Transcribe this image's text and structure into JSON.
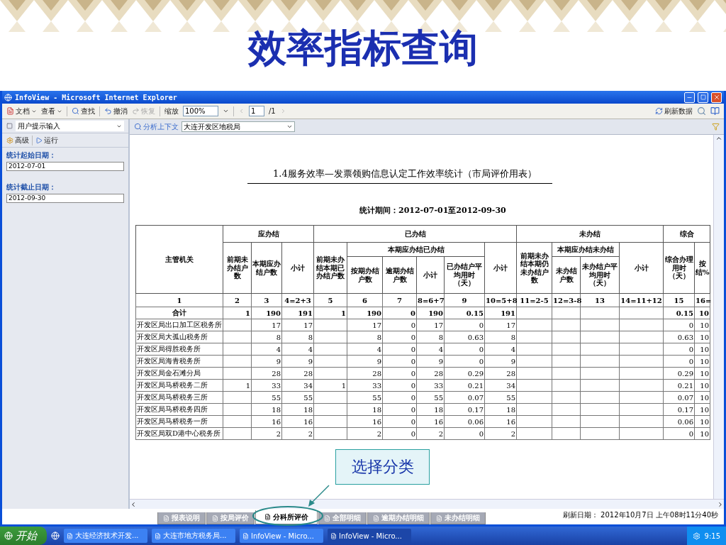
{
  "slide_title": "效率指标查询",
  "window": {
    "title": "InfoView - Microsoft Internet Explorer"
  },
  "toolbar": {
    "menus": [
      "文档",
      "查看"
    ],
    "find": "查找",
    "undo": {
      "label": "撤消",
      "disabled": false
    },
    "redo": {
      "label": "恢复",
      "disabled": true
    },
    "zoom_label": "缩放",
    "zoom_value": "100%",
    "page_value": "1",
    "page_total": "/1",
    "refresh": "刷新数据"
  },
  "prompt_panel": {
    "selector": "用户提示输入",
    "advanced": "高级",
    "run": "运行",
    "fields": [
      {
        "label": "统计起始日期：",
        "value": "2012-07-01"
      },
      {
        "label": "统计截止日期：",
        "value": "2012-09-30"
      }
    ]
  },
  "context_bar": {
    "label": "分析上下文",
    "value": "大连开发区地税局"
  },
  "report": {
    "title": "1.4服务效率—发票领购信息认定工作效率统计（市局评价用表）",
    "period": "统计期间：2012-07-01至2012-09-30",
    "columns": [
      {
        "label": "主管机关"
      },
      {
        "label": "应办结",
        "colspan": 3,
        "children": [
          {
            "label": "前期未办结户数"
          },
          {
            "label": "本期应办结户数"
          },
          {
            "label": "小计"
          }
        ]
      },
      {
        "label": "已办结",
        "colspan": 6,
        "children": [
          {
            "label": "前期未办结本期已办结户数"
          },
          {
            "label": "本期应办结已办结",
            "colspan": 4,
            "children": [
              {
                "label": "按期办结户数"
              },
              {
                "label": "逾期办结户数"
              },
              {
                "label": "小计"
              },
              {
                "label": "已办结户平均用时（天）"
              }
            ]
          },
          {
            "label": "小计"
          }
        ]
      },
      {
        "label": "未办结",
        "colspan": 4,
        "children": [
          {
            "label": "前期未办结本期仍未办结户数"
          },
          {
            "label": "本期应办结未办结",
            "colspan": 2,
            "children": [
              {
                "label": "未办结户数"
              },
              {
                "label": "未办结户平均用时（天）"
              }
            ]
          },
          {
            "label": "小计"
          }
        ]
      },
      {
        "label": "综合",
        "colspan": 2,
        "children": [
          {
            "label": "综合办理用时（天）"
          },
          {
            "label": "按结%"
          }
        ]
      }
    ],
    "index_row": [
      "1",
      "2",
      "3",
      "4=2+3",
      "5",
      "6",
      "7",
      "8=6+7",
      "9",
      "10=5+8",
      "11=2-5",
      "12=3-8",
      "13",
      "14=11+12",
      "15",
      "16="
    ],
    "rows": [
      {
        "kind": "total",
        "cells": [
          "合计",
          "1",
          "190",
          "191",
          "1",
          "190",
          "0",
          "190",
          "0.15",
          "191",
          null,
          null,
          null,
          null,
          "0.15",
          "10"
        ]
      },
      {
        "kind": "office",
        "cells": [
          "开发区局出口加工区税务所",
          null,
          "17",
          "17",
          null,
          "17",
          "0",
          "17",
          "0",
          "17",
          null,
          null,
          null,
          null,
          "0",
          "10"
        ]
      },
      {
        "kind": "office",
        "cells": [
          "开发区局大孤山税务所",
          null,
          "8",
          "8",
          null,
          "8",
          "0",
          "8",
          "0.63",
          "8",
          null,
          null,
          null,
          null,
          "0.63",
          "10"
        ]
      },
      {
        "kind": "office",
        "cells": [
          "开发区局得胜税务所",
          null,
          "4",
          "4",
          null,
          "4",
          "0",
          "4",
          "0",
          "4",
          null,
          null,
          null,
          null,
          "0",
          "10"
        ]
      },
      {
        "kind": "office",
        "cells": [
          "开发区局海青税务所",
          null,
          "9",
          "9",
          null,
          "9",
          "0",
          "9",
          "0",
          "9",
          null,
          null,
          null,
          null,
          "0",
          "10"
        ]
      },
      {
        "kind": "office",
        "cells": [
          "开发区局金石滩分局",
          null,
          "28",
          "28",
          null,
          "28",
          "0",
          "28",
          "0.29",
          "28",
          null,
          null,
          null,
          null,
          "0.29",
          "10"
        ]
      },
      {
        "kind": "office",
        "cells": [
          "开发区局马桥税务二所",
          "1",
          "33",
          "34",
          "1",
          "33",
          "0",
          "33",
          "0.21",
          "34",
          null,
          null,
          null,
          null,
          "0.21",
          "10"
        ]
      },
      {
        "kind": "office",
        "cells": [
          "开发区局马桥税务三所",
          null,
          "55",
          "55",
          null,
          "55",
          "0",
          "55",
          "0.07",
          "55",
          null,
          null,
          null,
          null,
          "0.07",
          "10"
        ]
      },
      {
        "kind": "office",
        "cells": [
          "开发区局马桥税务四所",
          null,
          "18",
          "18",
          null,
          "18",
          "0",
          "18",
          "0.17",
          "18",
          null,
          null,
          null,
          null,
          "0.17",
          "10"
        ]
      },
      {
        "kind": "office",
        "cells": [
          "开发区局马桥税务一所",
          null,
          "16",
          "16",
          null,
          "16",
          "0",
          "16",
          "0.06",
          "16",
          null,
          null,
          null,
          null,
          "0.06",
          "10"
        ]
      },
      {
        "kind": "office",
        "cells": [
          "开发区局双D港中心税务所",
          null,
          "2",
          "2",
          null,
          "2",
          "0",
          "2",
          "0",
          "2",
          null,
          null,
          null,
          null,
          "0",
          "10"
        ]
      }
    ]
  },
  "callout": {
    "text": "选择分类"
  },
  "report_tabs": [
    {
      "label": "报表说明",
      "selected": false
    },
    {
      "label": "按局评价",
      "selected": false
    },
    {
      "label": "分科所评价",
      "selected": true
    },
    {
      "label": "全部明细",
      "selected": false
    },
    {
      "label": "逾期办结明细",
      "selected": false
    },
    {
      "label": "未办结明细",
      "selected": false
    }
  ],
  "refresh_date": "刷新日期： 2012年10月7日 上午08时11分40秒",
  "taskbar": {
    "start": "开始",
    "tasks": [
      {
        "label": "大连经济技术开发...",
        "selected": false
      },
      {
        "label": "大连市地方税务局...",
        "selected": false
      },
      {
        "label": "InfoView - Micro...",
        "selected": false
      },
      {
        "label": "InfoView - Micro...",
        "selected": true
      }
    ],
    "clock": "9:15"
  }
}
